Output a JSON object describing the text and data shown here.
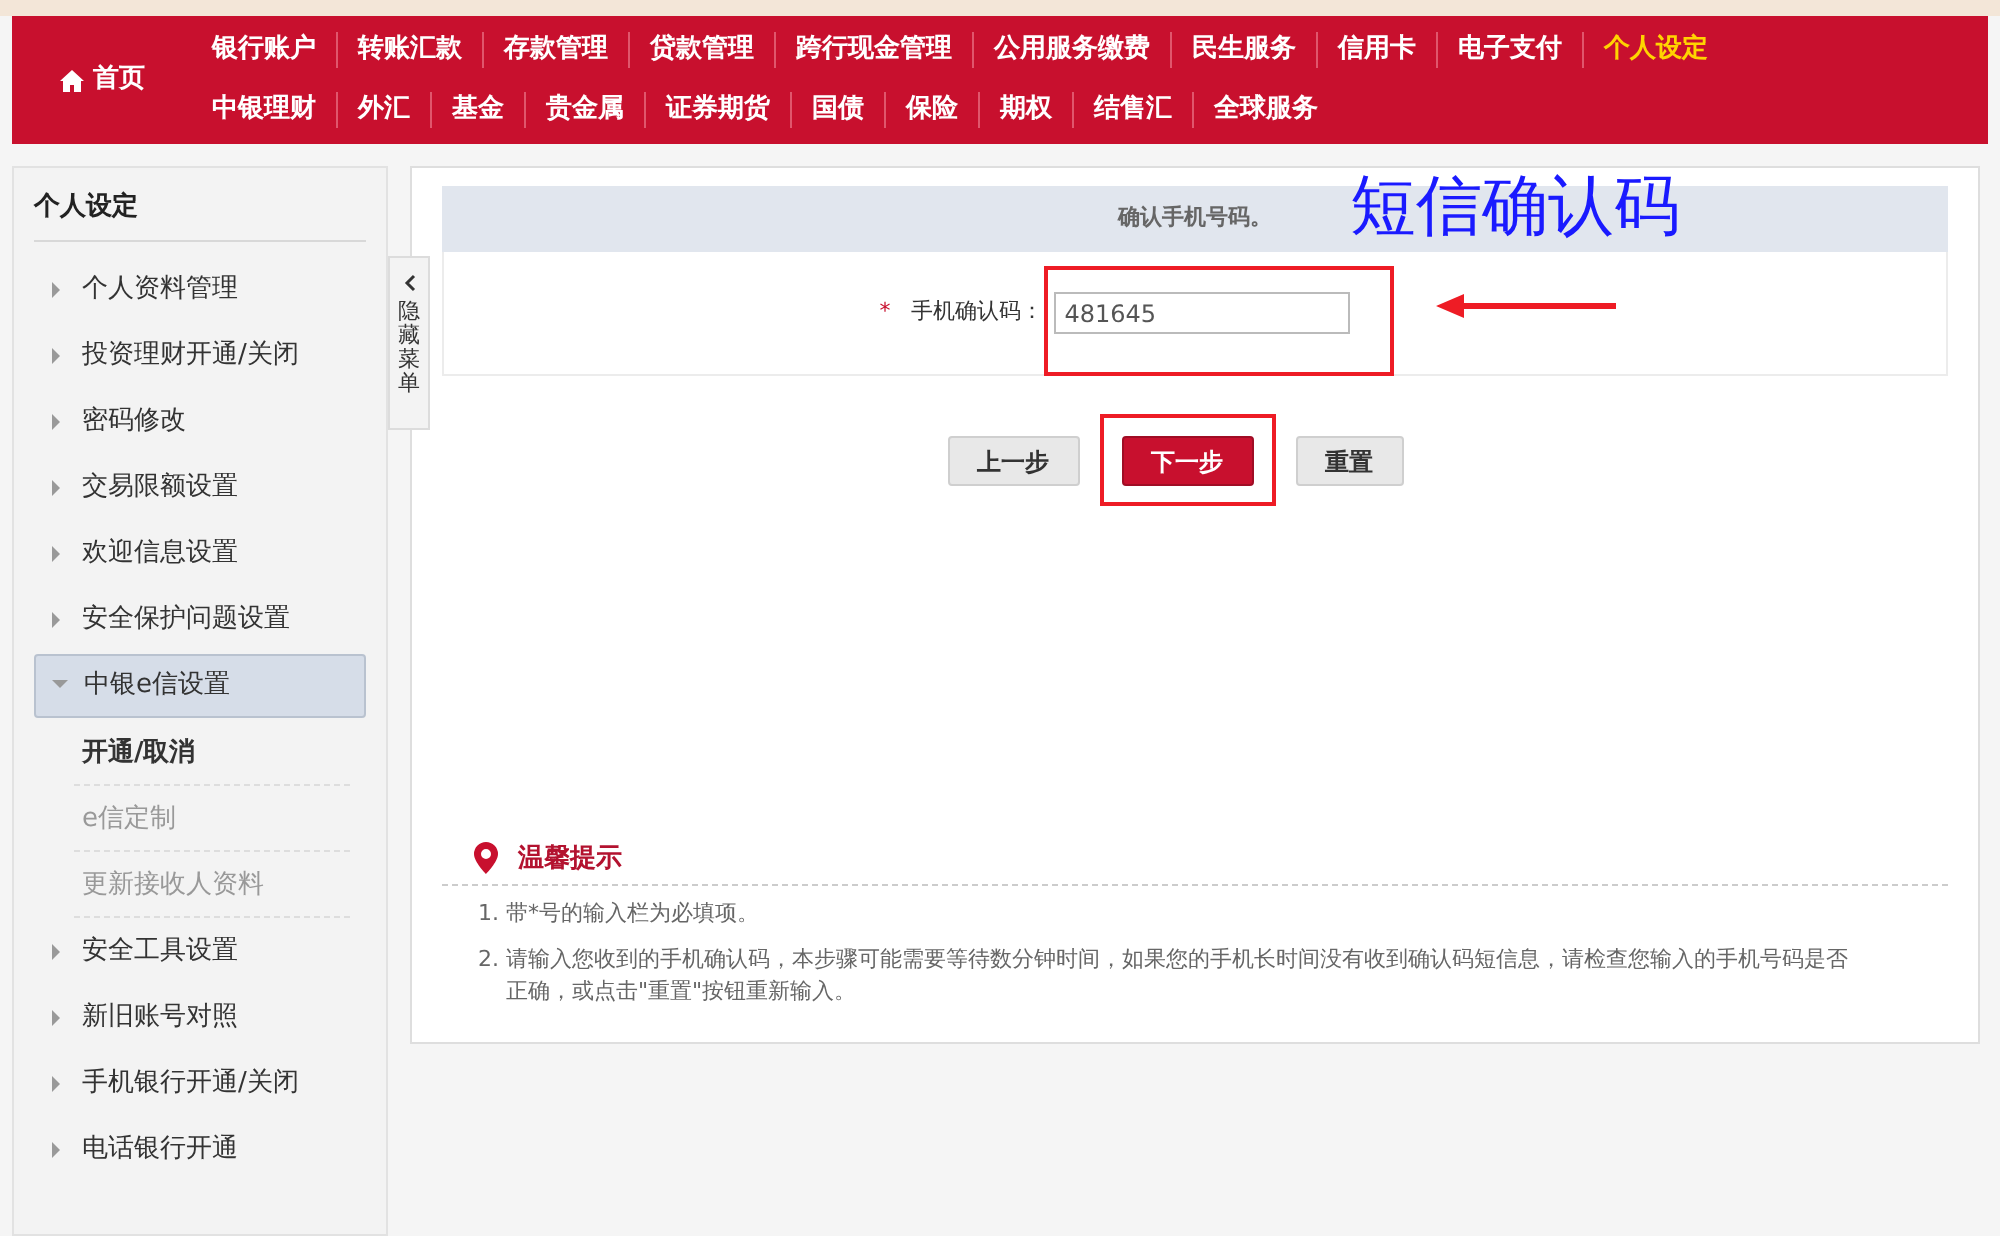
{
  "nav": {
    "home": "首页",
    "primary_tabs": [
      {
        "label": "银行账户",
        "selected": false
      },
      {
        "label": "转账汇款",
        "selected": false
      },
      {
        "label": "存款管理",
        "selected": false
      },
      {
        "label": "贷款管理",
        "selected": false
      },
      {
        "label": "跨行现金管理",
        "selected": false
      },
      {
        "label": "公用服务缴费",
        "selected": false
      },
      {
        "label": "民生服务",
        "selected": false
      },
      {
        "label": "信用卡",
        "selected": false
      },
      {
        "label": "电子支付",
        "selected": false
      },
      {
        "label": "个人设定",
        "selected": true
      }
    ],
    "secondary_tabs": [
      {
        "label": "中银理财",
        "selected": false
      },
      {
        "label": "外汇",
        "selected": false
      },
      {
        "label": "基金",
        "selected": false
      },
      {
        "label": "贵金属",
        "selected": false
      },
      {
        "label": "证券期货",
        "selected": false
      },
      {
        "label": "国债",
        "selected": false
      },
      {
        "label": "保险",
        "selected": false
      },
      {
        "label": "期权",
        "selected": false
      },
      {
        "label": "结售汇",
        "selected": false
      },
      {
        "label": "全球服务",
        "selected": false
      }
    ]
  },
  "sidebar": {
    "title": "个人设定",
    "items": [
      {
        "label": "个人资料管理",
        "expanded": false,
        "selected": false
      },
      {
        "label": "投资理财开通/关闭",
        "expanded": false,
        "selected": false
      },
      {
        "label": "密码修改",
        "expanded": false,
        "selected": false
      },
      {
        "label": "交易限额设置",
        "expanded": false,
        "selected": false
      },
      {
        "label": "欢迎信息设置",
        "expanded": false,
        "selected": false
      },
      {
        "label": "安全保护问题设置",
        "expanded": false,
        "selected": false
      },
      {
        "label": "中银e信设置",
        "expanded": true,
        "selected": true,
        "children": [
          {
            "label": "开通/取消",
            "selected": true
          },
          {
            "label": "e信定制",
            "selected": false
          },
          {
            "label": "更新接收人资料",
            "selected": false
          }
        ]
      },
      {
        "label": "安全工具设置",
        "expanded": false,
        "selected": false
      },
      {
        "label": "新旧账号对照",
        "expanded": false,
        "selected": false
      },
      {
        "label": "手机银行开通/关闭",
        "expanded": false,
        "selected": false
      },
      {
        "label": "电话银行开通",
        "expanded": false,
        "selected": false
      }
    ]
  },
  "hide_menu": {
    "label": "隐藏菜单"
  },
  "form": {
    "header": "确认手机号码。",
    "field": {
      "required_mark": "*",
      "label": "手机确认码：",
      "value": "481645"
    },
    "buttons": [
      {
        "label": "上一步",
        "kind": "secondary"
      },
      {
        "label": "下一步",
        "kind": "primary"
      },
      {
        "label": "重置",
        "kind": "secondary"
      }
    ]
  },
  "tips": {
    "title": "温馨提示",
    "items": [
      {
        "number": "1.",
        "text": "带*号的输入栏为必填项。"
      },
      {
        "number": "2.",
        "text": "请输入您收到的手机确认码，本步骤可能需要等待数分钟时间，如果您的手机长时间没有收到确认码短信息，请检查您输入的手机号码是否正确，或点击\"重置\"按钮重新输入。"
      }
    ]
  },
  "annotations": [
    {
      "kind": "text",
      "text": "短信确认码"
    },
    {
      "kind": "box"
    },
    {
      "kind": "box"
    },
    {
      "kind": "arrow"
    }
  ]
}
